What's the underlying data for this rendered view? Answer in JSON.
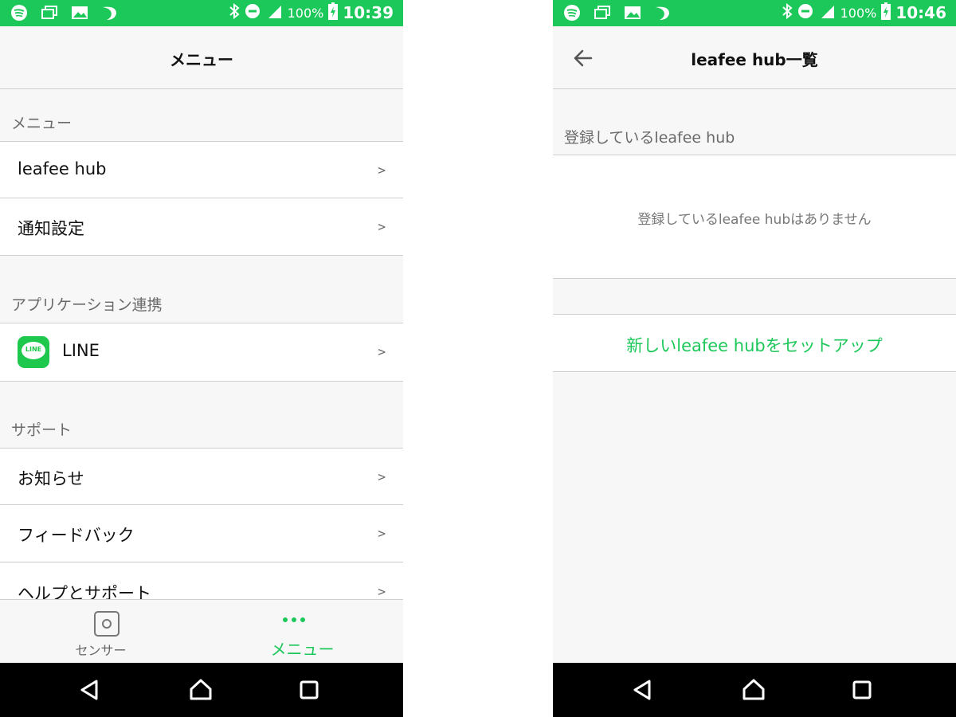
{
  "colors": {
    "brand": "#1dc85a",
    "line_brand": "#1ec84c",
    "text": "#111111",
    "muted": "#6a6a6a",
    "divider": "#cfcfcf"
  },
  "left": {
    "status": {
      "icons": [
        "spotify-icon",
        "cast-icon",
        "image-icon",
        "moon-icon"
      ],
      "battery": "100%",
      "time": "10:39"
    },
    "header": {
      "title": "メニュー"
    },
    "sections": [
      {
        "label": "メニュー",
        "items": [
          {
            "label": "leafee hub",
            "chevron": ">"
          },
          {
            "label": "通知設定",
            "chevron": ">"
          }
        ]
      },
      {
        "label": "アプリケーション連携",
        "items": [
          {
            "label": "LINE",
            "icon": "line-logo",
            "logo_text": "LINE",
            "chevron": ">"
          }
        ]
      },
      {
        "label": "サポート",
        "items": [
          {
            "label": "お知らせ",
            "chevron": ">"
          },
          {
            "label": "フィードバック",
            "chevron": ">"
          },
          {
            "label": "ヘルプとサポート",
            "chevron": ">"
          }
        ]
      }
    ],
    "tabbar": {
      "sensor_label": "センサー",
      "menu_label": "メニュー"
    }
  },
  "right": {
    "status": {
      "icons": [
        "spotify-icon",
        "cast-icon",
        "image-icon",
        "moon-icon"
      ],
      "battery": "100%",
      "time": "10:46"
    },
    "header": {
      "title": "leafee hub一覧"
    },
    "section_label": "登録しているleafee hub",
    "empty_text": "登録しているleafee hubはありません",
    "setup_label": "新しいleafee hubをセットアップ"
  }
}
